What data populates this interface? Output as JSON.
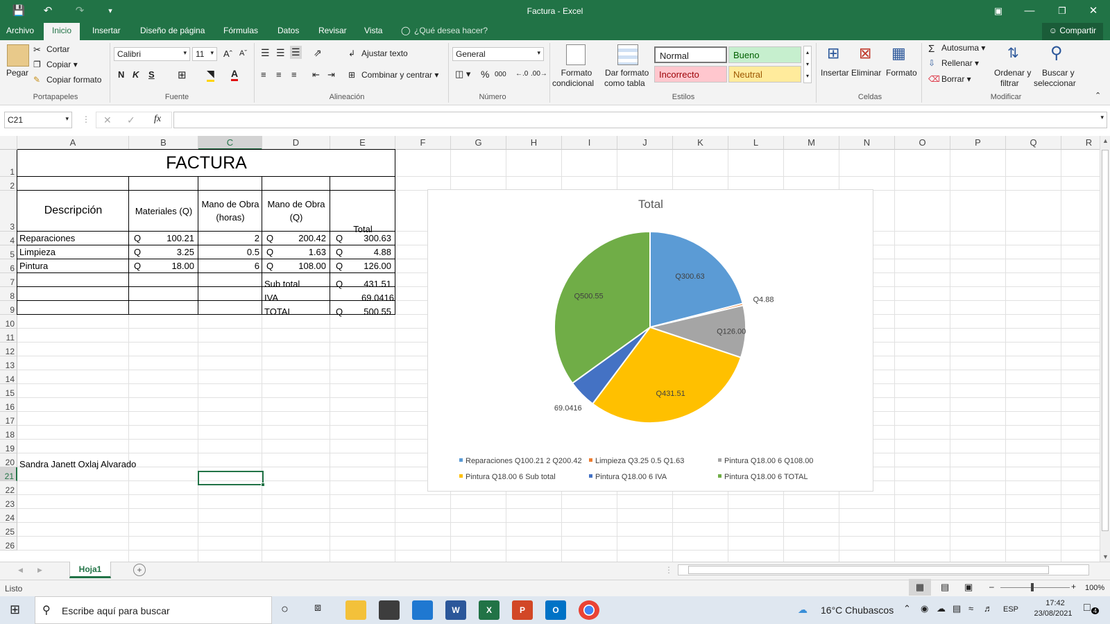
{
  "window": {
    "title": "Factura - Excel"
  },
  "tabs": [
    "Archivo",
    "Inicio",
    "Insertar",
    "Diseño de página",
    "Fórmulas",
    "Datos",
    "Revisar",
    "Vista"
  ],
  "tell_me": "¿Qué desea hacer?",
  "share": "Compartir",
  "ribbon": {
    "clipboard": {
      "paste": "Pegar",
      "cut": "Cortar",
      "copy": "Copiar",
      "format_painter": "Copiar formato",
      "label": "Portapapeles"
    },
    "font": {
      "name": "Calibri",
      "size": "11",
      "bold": "N",
      "italic": "K",
      "underline": "S",
      "label": "Fuente"
    },
    "alignment": {
      "wrap": "Ajustar texto",
      "merge": "Combinar y centrar",
      "label": "Alineación"
    },
    "number": {
      "format": "General",
      "percent": "%",
      "thousands": "000",
      "label": "Número"
    },
    "styles": {
      "cond_format_1": "Formato",
      "cond_format_2": "condicional",
      "table_1": "Dar formato",
      "table_2": "como tabla",
      "normal": "Normal",
      "good": "Bueno",
      "bad": "Incorrecto",
      "neutral": "Neutral",
      "label": "Estilos"
    },
    "cells": {
      "insert": "Insertar",
      "delete": "Eliminar",
      "format": "Formato",
      "label": "Celdas"
    },
    "editing": {
      "autosum": "Autosuma",
      "fill": "Rellenar",
      "clear": "Borrar",
      "sort_1": "Ordenar y",
      "sort_2": "filtrar",
      "find_1": "Buscar y",
      "find_2": "seleccionar",
      "label": "Modificar"
    }
  },
  "formula_bar": {
    "name_box": "C21",
    "fx": "fx",
    "value": ""
  },
  "columns": [
    "A",
    "B",
    "C",
    "D",
    "E",
    "F",
    "G",
    "H",
    "I",
    "J",
    "K",
    "L",
    "M",
    "N",
    "O",
    "P",
    "Q",
    "R"
  ],
  "rows": [
    "1",
    "2",
    "3",
    "4",
    "5",
    "6",
    "7",
    "8",
    "9",
    "10",
    "11",
    "12",
    "13",
    "14",
    "15",
    "16",
    "17",
    "18",
    "19",
    "20",
    "21",
    "22",
    "23",
    "24",
    "25",
    "26"
  ],
  "sheet": {
    "title": "FACTURA",
    "headers": {
      "desc": "Descripción",
      "materiales": "Materiales  (Q)",
      "mano_horas_1": "Mano de Obra",
      "mano_horas_2": "(horas)",
      "mano_q_1": "Mano de Obra",
      "mano_q_2": "(Q)",
      "total": "Total"
    },
    "items": [
      {
        "desc": "Reparaciones",
        "q1": "Q",
        "materiales": "100.21",
        "horas": "2",
        "q2": "Q",
        "mano": "200.42",
        "q3": "Q",
        "total": "300.63"
      },
      {
        "desc": "Limpieza",
        "q1": "Q",
        "materiales": "3.25",
        "horas": "0.5",
        "q2": "Q",
        "mano": "1.63",
        "q3": "Q",
        "total": "4.88"
      },
      {
        "desc": "Pintura",
        "q1": "Q",
        "materiales": "18.00",
        "horas": "6",
        "q2": "Q",
        "mano": "108.00",
        "q3": "Q",
        "total": "126.00"
      }
    ],
    "subtotal": {
      "label": "Sub total",
      "q": "Q",
      "value": "431.51"
    },
    "iva": {
      "label": "IVA",
      "value": "69.0416"
    },
    "total": {
      "label": "TOTAL",
      "q": "Q",
      "value": "500.55"
    },
    "author": "Sandra Janett Oxlaj Alvarado"
  },
  "chart_data": {
    "type": "pie",
    "title": "Total",
    "values": [
      300.63,
      4.88,
      126.0,
      431.51,
      69.0416,
      500.55
    ],
    "labels": [
      "Q300.63",
      "Q4.88",
      "Q126.00",
      "Q431.51",
      "69.0416",
      "Q500.55"
    ],
    "legend": [
      "Reparaciones  Q100.21  2  Q200.42",
      "Limpieza  Q3.25  0.5  Q1.63",
      "Pintura  Q18.00  6  Q108.00",
      "Pintura  Q18.00  6 Sub total",
      "Pintura  Q18.00  6 IVA",
      "Pintura  Q18.00  6 TOTAL"
    ],
    "colors": [
      "#5b9bd5",
      "#ed7d31",
      "#a5a5a5",
      "#ffc000",
      "#4472c4",
      "#70ad47"
    ],
    "legend_position": "bottom"
  },
  "sheet_tab": "Hoja1",
  "status": {
    "ready": "Listo",
    "zoom": "100%"
  },
  "taskbar": {
    "search": "Escribe aquí para buscar",
    "weather": "16°C  Chubascos",
    "lang": "ESP",
    "time": "17:42",
    "date": "23/08/2021",
    "notif": "4"
  }
}
